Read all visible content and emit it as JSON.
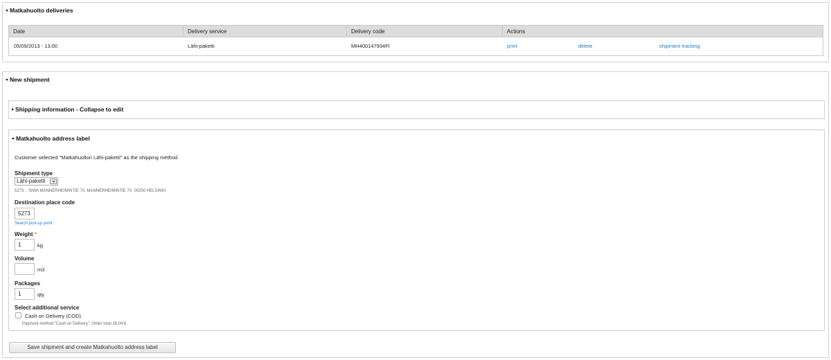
{
  "deliveries": {
    "legend": "Matkahuolto deliveries",
    "columns": [
      "Date",
      "Delivery service",
      "Delivery code",
      "Actions"
    ],
    "rows": [
      {
        "date": "05/09/2013 - 13:00",
        "service": "Lähi-paketti",
        "code": "MH400147934FI",
        "print": "print",
        "delete": "delete",
        "tracking": "shipment tracking"
      }
    ]
  },
  "new_shipment": {
    "legend": "New shipment",
    "shipping_info_legend": "Shipping information - Collapse to edit",
    "address_label_legend": "Matkahuolto address label",
    "customer_note": "Customer selected \"Matkahuollon Lähi-paketti\" as the shipping method.",
    "shipment_type": {
      "label": "Shipment type",
      "value": "Lähi-paketti",
      "address": "5273 :: SIWA MANNERHEIMINTIE 70, MANNERHEIMINTIE 70, 00250 HELSINKI"
    },
    "destination": {
      "label": "Destination place code",
      "value": "5273",
      "link": "Search pick-up point"
    },
    "weight": {
      "label": "Weight",
      "required": "*",
      "value": "1",
      "unit": "kg"
    },
    "volume": {
      "label": "Volume",
      "value": "",
      "unit": "m3"
    },
    "packages": {
      "label": "Packages",
      "value": "1",
      "unit": "qty"
    },
    "additional": {
      "label": "Select additional service",
      "cod_label": "Cash on Delivery (COD)",
      "cod_note": "Payment method \"Cash on Delivery\". Order total 26.04 €"
    },
    "save_button": "Save shipment and create Matkahuolto address label"
  }
}
